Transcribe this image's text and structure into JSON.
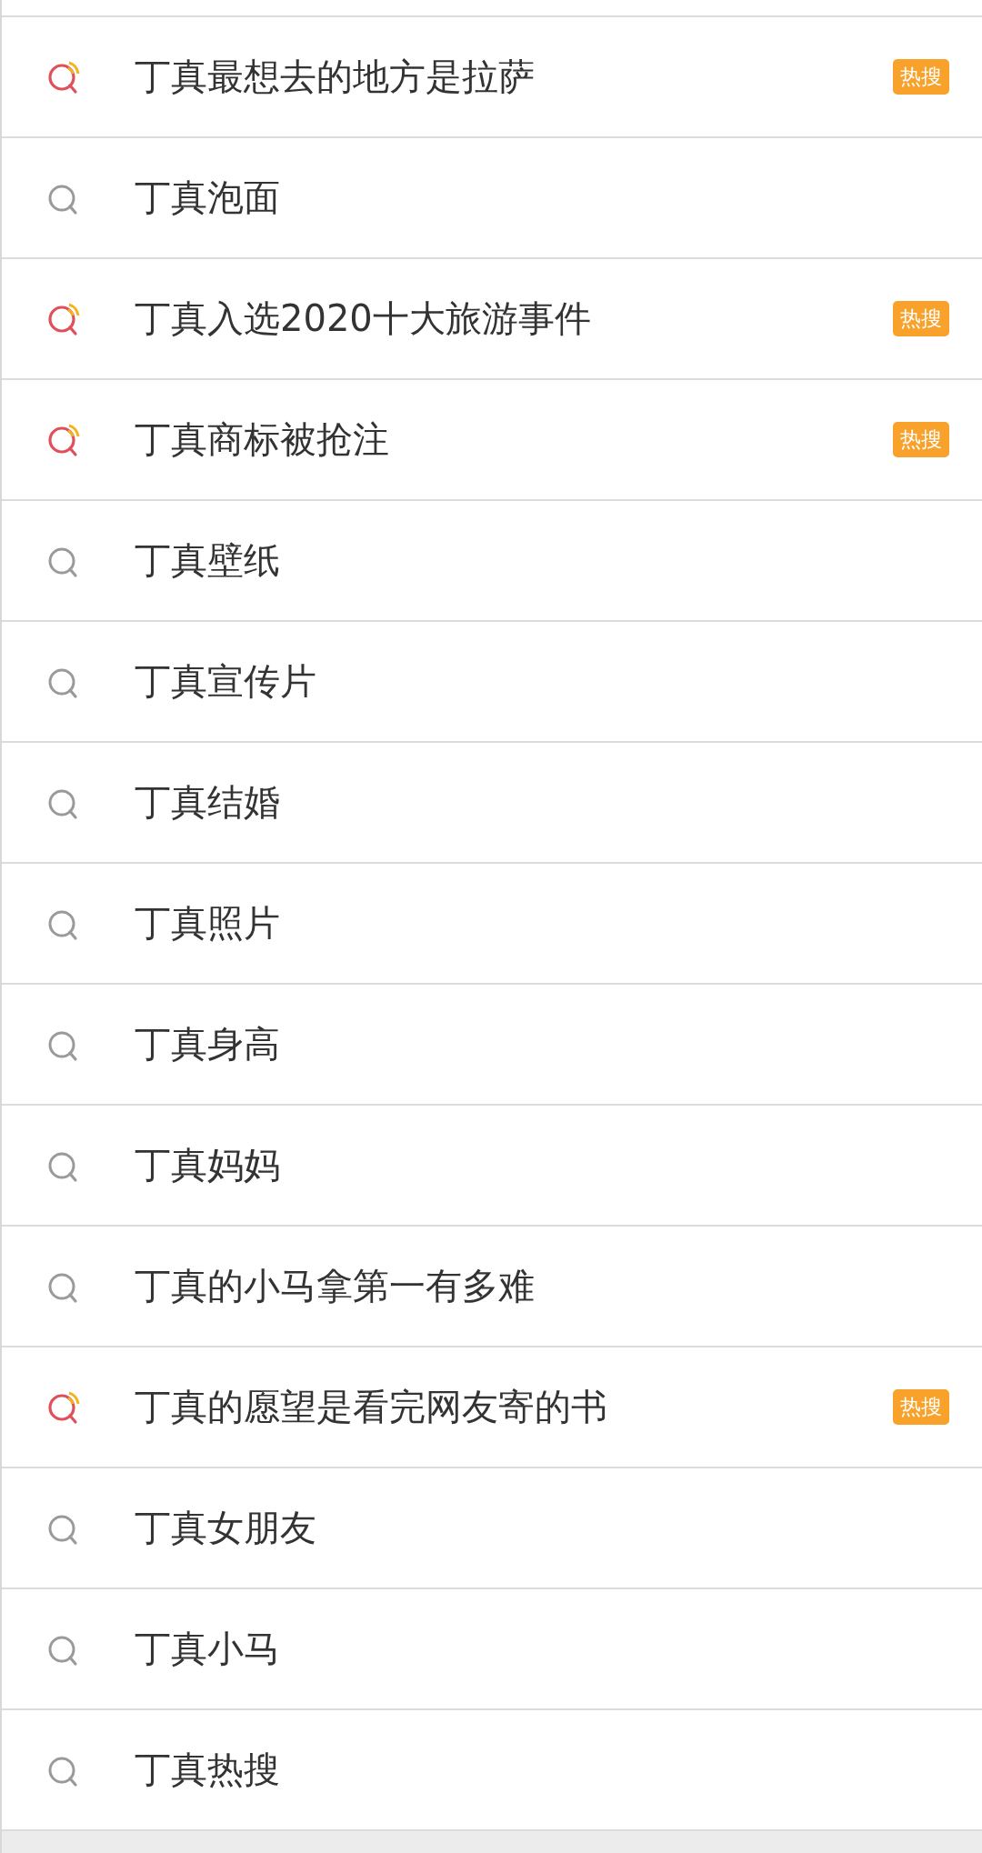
{
  "suggestions": [
    {
      "text": "丁真最想去的地方是拉萨",
      "hot": true,
      "badge": "热搜"
    },
    {
      "text": "丁真泡面",
      "hot": false
    },
    {
      "text": "丁真入选2020十大旅游事件",
      "hot": true,
      "badge": "热搜"
    },
    {
      "text": "丁真商标被抢注",
      "hot": true,
      "badge": "热搜"
    },
    {
      "text": "丁真壁纸",
      "hot": false
    },
    {
      "text": "丁真宣传片",
      "hot": false
    },
    {
      "text": "丁真结婚",
      "hot": false
    },
    {
      "text": "丁真照片",
      "hot": false
    },
    {
      "text": "丁真身高",
      "hot": false
    },
    {
      "text": "丁真妈妈",
      "hot": false
    },
    {
      "text": "丁真的小马拿第一有多难",
      "hot": false
    },
    {
      "text": "丁真的愿望是看完网友寄的书",
      "hot": true,
      "badge": "热搜"
    },
    {
      "text": "丁真女朋友",
      "hot": false
    },
    {
      "text": "丁真小马",
      "hot": false
    },
    {
      "text": "丁真热搜",
      "hot": false
    }
  ]
}
